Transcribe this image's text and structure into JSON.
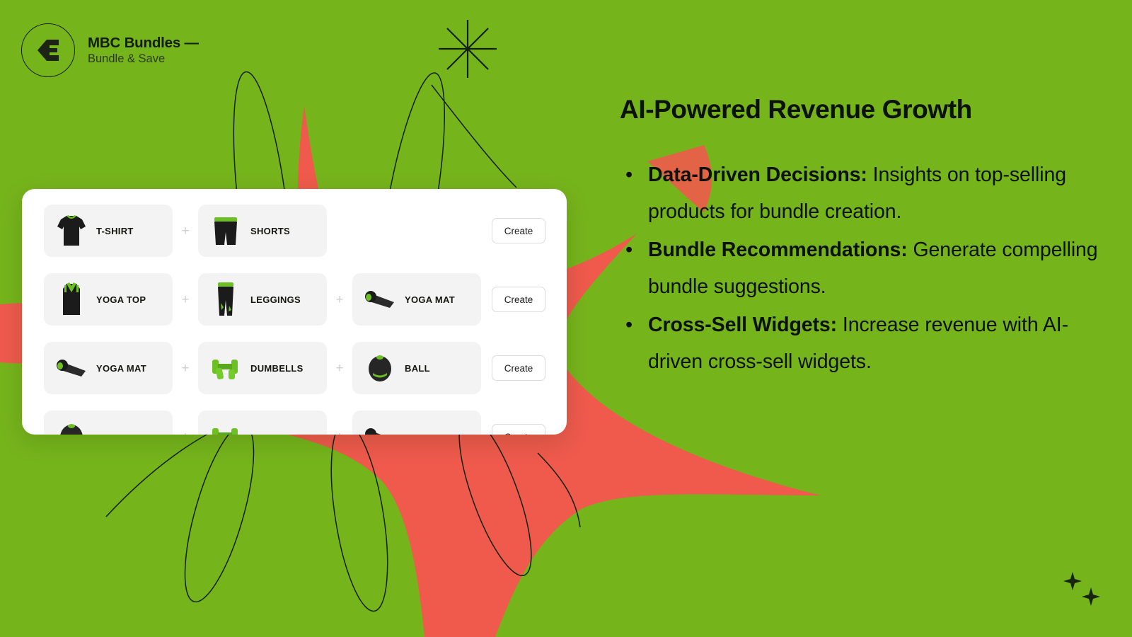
{
  "theme": {
    "background_green": "#76b41c",
    "accent_red": "#ef5a4c",
    "ink": "#0d1208",
    "card_white": "#ffffff",
    "tile_gray": "#f3f3f3",
    "product_green": "#6cc024"
  },
  "brand": {
    "logo_icon": "mbc-monogram-icon",
    "title": "MBC Bundles —",
    "subtitle": "Bundle & Save"
  },
  "product_card": {
    "create_label": "Create",
    "plus_symbol": "+",
    "rows": [
      {
        "items": [
          {
            "label": "T-SHIRT",
            "icon": "tshirt-icon"
          },
          {
            "label": "SHORTS",
            "icon": "shorts-icon"
          }
        ],
        "action": "Create"
      },
      {
        "items": [
          {
            "label": "YOGA TOP",
            "icon": "yoga-top-icon"
          },
          {
            "label": "LEGGINGS",
            "icon": "leggings-icon"
          },
          {
            "label": "YOGA MAT",
            "icon": "yoga-mat-icon"
          }
        ],
        "action": "Create"
      },
      {
        "items": [
          {
            "label": "YOGA MAT",
            "icon": "yoga-mat-icon"
          },
          {
            "label": "DUMBELLS",
            "icon": "dumbbells-icon"
          },
          {
            "label": "BALL",
            "icon": "ball-icon"
          }
        ],
        "action": "Create"
      },
      {
        "items": [
          {
            "label": "",
            "icon": "ball-icon"
          },
          {
            "label": "",
            "icon": "dumbbells-icon"
          },
          {
            "label": "",
            "icon": "yoga-mat-icon"
          }
        ],
        "action": "Create"
      }
    ]
  },
  "copy": {
    "title": "AI-Powered Revenue Growth",
    "bullet_marker": "•",
    "bullets": [
      {
        "lead": "Data-Driven Decisions:",
        "rest": " Insights on top-selling products for bundle creation."
      },
      {
        "lead": "Bundle Recommendations:",
        "rest": " Generate compelling bundle suggestions."
      },
      {
        "lead": "Cross-Sell Widgets:",
        "rest": " Increase revenue with AI-driven cross-sell widgets."
      }
    ]
  },
  "decor": {
    "starburst_icon": "eight-point-starburst-icon",
    "sparkle_icons": [
      "sparkle-icon",
      "sparkle-icon"
    ],
    "petal_outlines": 6,
    "red_star_shape": "red-starburst-shape"
  }
}
